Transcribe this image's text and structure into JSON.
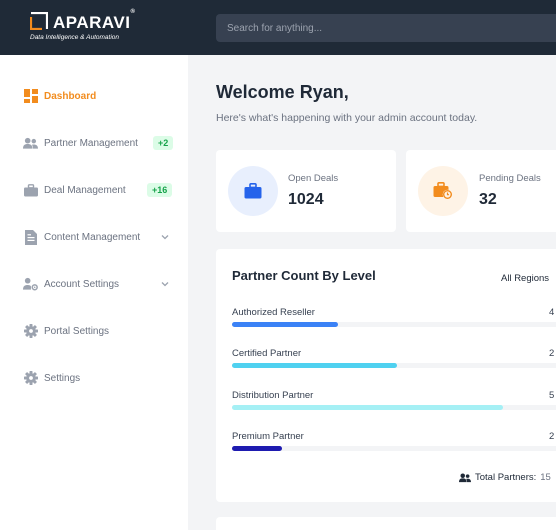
{
  "brand": {
    "name": "APARAVI",
    "registered": "®",
    "tagline": "Data Intelligence & Automation",
    "colors": {
      "accent": "#f28c1e",
      "topbar": "#1f2a37"
    }
  },
  "search": {
    "placeholder": "Search for anything..."
  },
  "sidebar": {
    "items": [
      {
        "label": "Dashboard",
        "icon": "dashboard-icon",
        "active": true
      },
      {
        "label": "Partner Management",
        "icon": "users-icon",
        "badge": "+2"
      },
      {
        "label": "Deal Management",
        "icon": "briefcase-icon",
        "badge": "+16"
      },
      {
        "label": "Content Management",
        "icon": "document-icon",
        "expandable": true
      },
      {
        "label": "Account Settings",
        "icon": "user-cog-icon",
        "expandable": true
      },
      {
        "label": "Portal Settings",
        "icon": "gear-icon"
      },
      {
        "label": "Settings",
        "icon": "gear-icon"
      }
    ]
  },
  "main": {
    "welcome": "Welcome Ryan,",
    "subtitle": "Here's what's happening with your admin account today.",
    "stats": [
      {
        "label": "Open Deals",
        "value": "1024",
        "icon": "briefcase-icon",
        "color": "#2563eb"
      },
      {
        "label": "Pending Deals",
        "value": "32",
        "icon": "briefcase-clock-icon",
        "color": "#f28c1e"
      }
    ],
    "partner_levels": {
      "title": "Partner Count By Level",
      "region": "All Regions",
      "levels": [
        {
          "name": "Authorized Reseller",
          "count": "4",
          "fill": 0.32,
          "color": "#3b82f6"
        },
        {
          "name": "Certified Partner",
          "count": "2",
          "fill": 0.5,
          "color": "#4fd1f0"
        },
        {
          "name": "Distribution Partner",
          "count": "5",
          "fill": 0.82,
          "color": "#a5f0f5"
        },
        {
          "name": "Premium Partner",
          "count": "2",
          "fill": 0.15,
          "color": "#1e1bb0"
        }
      ],
      "total_label": "Total Partners:",
      "total_value": "15"
    }
  }
}
